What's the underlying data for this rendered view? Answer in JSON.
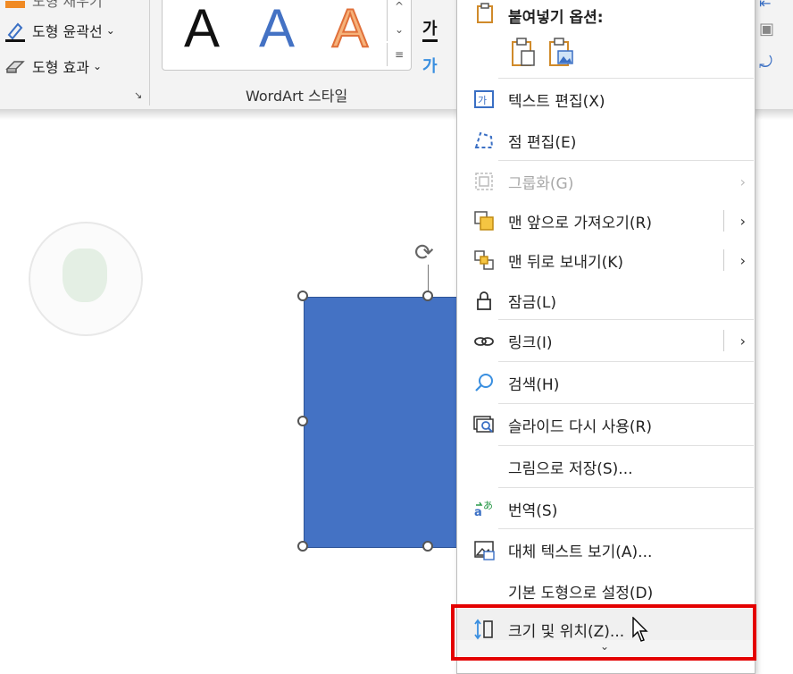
{
  "ribbon": {
    "row_outline": "도형 윤곽선",
    "row_effect": "도형 효과",
    "row_fill_partial": "도형 채우기",
    "wordart_label": "WordArt 스타일",
    "wordart_letter": "A",
    "text_fill_glyph": "가",
    "text_outline_glyph": "가"
  },
  "menu": {
    "paste_title": "붙여넣기 옵션:",
    "items": [
      {
        "label": "텍스트 편집(X)",
        "icon": "edit-text-icon",
        "disabled": false,
        "submenu": false
      },
      {
        "label": "점 편집(E)",
        "icon": "edit-points-icon",
        "disabled": false,
        "submenu": false
      },
      {
        "label": "그룹화(G)",
        "icon": "group-icon",
        "disabled": true,
        "submenu": true
      },
      {
        "label": "맨 앞으로 가져오기(R)",
        "icon": "bring-to-front-icon",
        "disabled": false,
        "submenu": true
      },
      {
        "label": "맨 뒤로 보내기(K)",
        "icon": "send-to-back-icon",
        "disabled": false,
        "submenu": true
      },
      {
        "label": "잠금(L)",
        "icon": "lock-icon",
        "disabled": false,
        "submenu": false
      },
      {
        "label": "링크(I)",
        "icon": "link-icon",
        "disabled": false,
        "submenu": true
      },
      {
        "label": "검색(H)",
        "icon": "search-icon",
        "disabled": false,
        "submenu": false
      },
      {
        "label": "슬라이드 다시 사용(R)",
        "icon": "reuse-slides-icon",
        "disabled": false,
        "submenu": false
      },
      {
        "label": "그림으로 저장(S)...",
        "icon": "",
        "disabled": false,
        "submenu": false
      },
      {
        "label": "번역(S)",
        "icon": "translate-icon",
        "disabled": false,
        "submenu": false
      },
      {
        "label": "대체 텍스트 보기(A)...",
        "icon": "alt-text-icon",
        "disabled": false,
        "submenu": false
      },
      {
        "label": "기본 도형으로 설정(D)",
        "icon": "",
        "disabled": false,
        "submenu": false
      },
      {
        "label": "크기 및 위치(Z)...",
        "icon": "size-position-icon",
        "disabled": false,
        "submenu": false
      }
    ]
  },
  "colors": {
    "shape_fill": "#4472c4",
    "highlight": "#e40000"
  }
}
